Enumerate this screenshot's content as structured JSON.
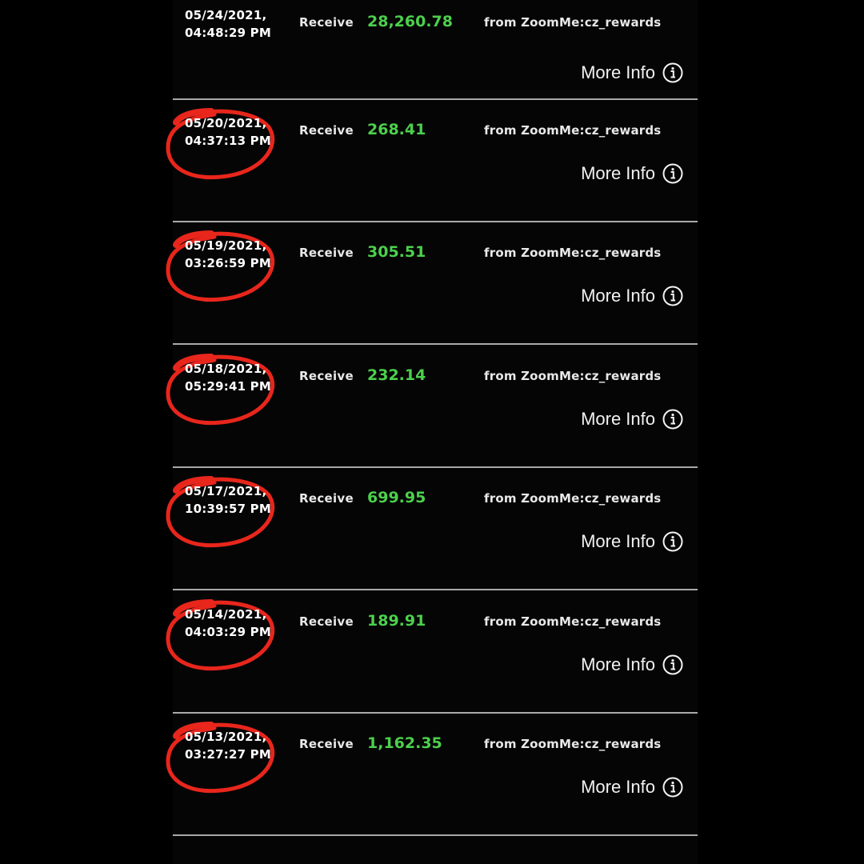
{
  "transactions": [
    {
      "date": "05/24/2021,",
      "time": "04:48:29 PM",
      "type": "Receive",
      "amount": "28,260.78",
      "source": "from ZoomMe:cz_rewards",
      "more_info": "More Info",
      "circled": false
    },
    {
      "date": "05/20/2021,",
      "time": "04:37:13 PM",
      "type": "Receive",
      "amount": "268.41",
      "source": "from ZoomMe:cz_rewards",
      "more_info": "More Info",
      "circled": true
    },
    {
      "date": "05/19/2021,",
      "time": "03:26:59 PM",
      "type": "Receive",
      "amount": "305.51",
      "source": "from ZoomMe:cz_rewards",
      "more_info": "More Info",
      "circled": true
    },
    {
      "date": "05/18/2021,",
      "time": "05:29:41 PM",
      "type": "Receive",
      "amount": "232.14",
      "source": "from ZoomMe:cz_rewards",
      "more_info": "More Info",
      "circled": true
    },
    {
      "date": "05/17/2021,",
      "time": "10:39:57 PM",
      "type": "Receive",
      "amount": "699.95",
      "source": "from ZoomMe:cz_rewards",
      "more_info": "More Info",
      "circled": true
    },
    {
      "date": "05/14/2021,",
      "time": "04:03:29 PM",
      "type": "Receive",
      "amount": "189.91",
      "source": "from ZoomMe:cz_rewards",
      "more_info": "More Info",
      "circled": true
    },
    {
      "date": "05/13/2021,",
      "time": "03:27:27 PM",
      "type": "Receive",
      "amount": "1,162.35",
      "source": "from ZoomMe:cz_rewards",
      "more_info": "More Info",
      "circled": true
    }
  ],
  "icons": {
    "more_info": "info-circle-icon",
    "annotation": "red-circle-annotation"
  },
  "colors": {
    "background": "#000000",
    "amount": "#4cd04c",
    "divider": "#a9a9a9",
    "annotation": "#e8261c",
    "text": "#ffffff"
  }
}
